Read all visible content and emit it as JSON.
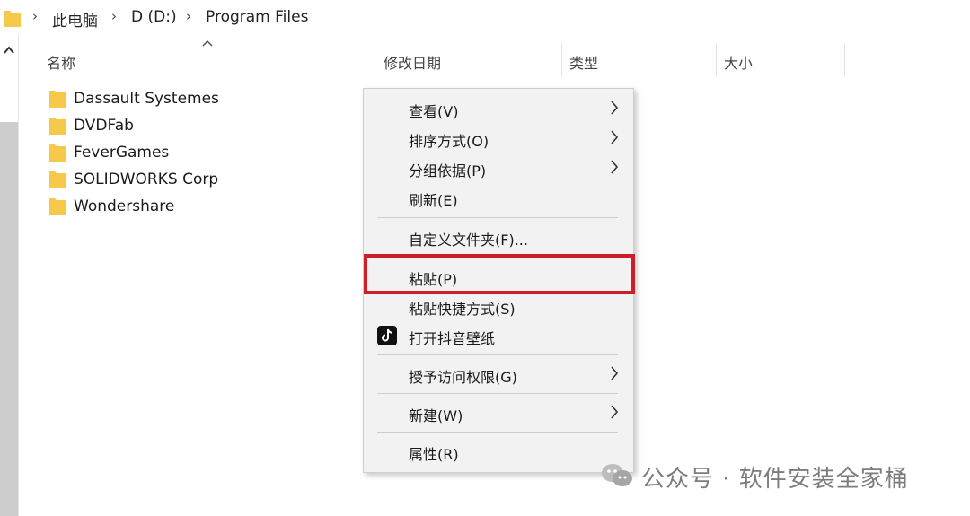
{
  "breadcrumb": {
    "items": [
      "此电脑",
      "D (D:)",
      "Program Files"
    ]
  },
  "columns": {
    "name": "名称",
    "modified": "修改日期",
    "type": "类型",
    "size": "大小"
  },
  "files": [
    {
      "name": "Dassault Systemes"
    },
    {
      "name": "DVDFab"
    },
    {
      "name": "FeverGames"
    },
    {
      "name": "SOLIDWORKS Corp"
    },
    {
      "name": "Wondershare"
    }
  ],
  "context_menu": {
    "items": [
      {
        "label": "查看(V)",
        "submenu": true
      },
      {
        "label": "排序方式(O)",
        "submenu": true
      },
      {
        "label": "分组依据(P)",
        "submenu": true
      },
      {
        "label": "刷新(E)",
        "submenu": false
      },
      {
        "label": "自定义文件夹(F)...",
        "submenu": false
      },
      {
        "label": "粘贴(P)",
        "submenu": false,
        "highlighted": true
      },
      {
        "label": "粘贴快捷方式(S)",
        "submenu": false
      },
      {
        "label": "打开抖音壁纸",
        "submenu": false,
        "icon": "tiktok-icon"
      },
      {
        "label": "授予访问权限(G)",
        "submenu": true
      },
      {
        "label": "新建(W)",
        "submenu": true
      },
      {
        "label": "属性(R)",
        "submenu": false
      }
    ]
  },
  "watermark": {
    "text": "公众号 · 软件安装全家桶",
    "icon": "wechat-icon"
  },
  "colors": {
    "folder": "#f7c94a",
    "highlight_border": "#cc1f2a",
    "menu_bg": "#f2f2f2"
  }
}
